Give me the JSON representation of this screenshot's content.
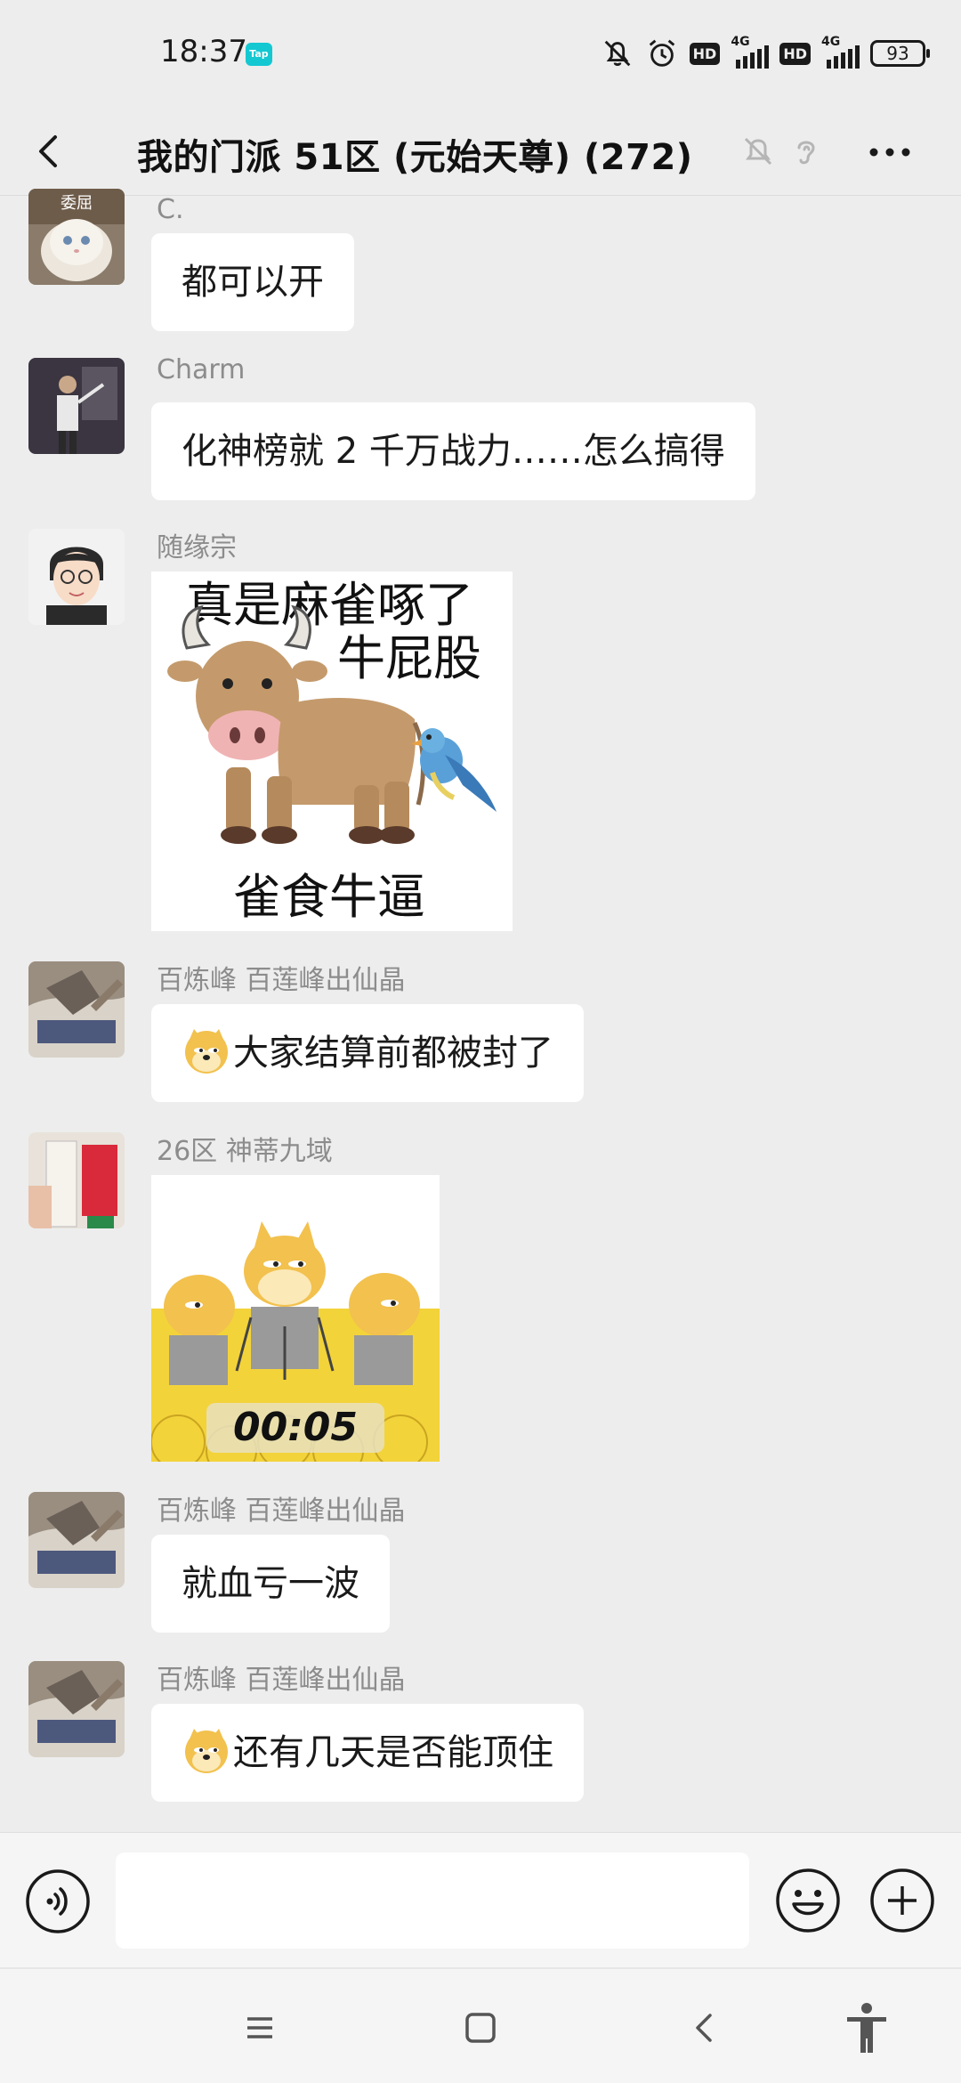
{
  "status_bar": {
    "time": "18:37",
    "tap_badge": "Tap",
    "icons": [
      "mute-bell-icon",
      "alarm-icon",
      "hd-icon",
      "signal-icon",
      "hd-icon",
      "signal-icon"
    ],
    "hd_label": "HD",
    "network_label": "4G",
    "battery": "93"
  },
  "header": {
    "title": "我的门派 51区 (元始天尊) (272)",
    "icons": [
      "back-icon",
      "mute-icon",
      "earpiece-icon",
      "more-icon"
    ]
  },
  "messages": [
    {
      "sender": "C.",
      "avatar_label": "委屈",
      "type": "text",
      "text": "都可以开"
    },
    {
      "sender": "Charm",
      "type": "text",
      "text": "化神榜就 2 千万战力……怎么搞得"
    },
    {
      "sender": "随缘宗",
      "type": "sticker",
      "sticker_text": [
        "真是麻雀啄了",
        "牛屁股",
        "雀食牛逼"
      ]
    },
    {
      "sender": "百炼峰  百莲峰出仙晶",
      "type": "text",
      "emoji": "doge",
      "text": "大家结算前都被封了"
    },
    {
      "sender": "26区 神蒂九域",
      "type": "sticker",
      "sticker_text": [
        "00:05"
      ]
    },
    {
      "sender": "百炼峰  百莲峰出仙晶",
      "type": "text",
      "text": "就血亏一波"
    },
    {
      "sender": "百炼峰  百莲峰出仙晶",
      "type": "text",
      "emoji": "doge",
      "text": "还有几天是否能顶住"
    }
  ],
  "input_bar": {
    "placeholder": "",
    "icons": [
      "voice-icon",
      "emoji-icon",
      "plus-icon"
    ]
  },
  "nav_bar": {
    "icons": [
      "menu-icon",
      "home-icon",
      "back-nav-icon",
      "accessibility-icon"
    ]
  },
  "colors": {
    "background": "#ededed",
    "bubble": "#ffffff",
    "nickname": "#8c8c8c",
    "tap_badge": "#14c8d2"
  }
}
